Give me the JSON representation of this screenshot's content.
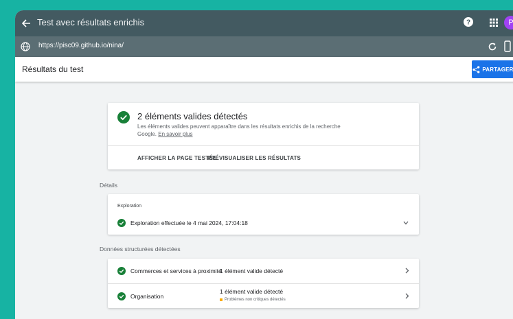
{
  "header": {
    "title": "Test avec résultats enrichis",
    "avatar_letter": "P"
  },
  "urlbar": {
    "url": "https://pisc09.github.io/nina/"
  },
  "appbar": {
    "heading": "Résultats du test",
    "share_label": "PARTAGER"
  },
  "summary": {
    "headline": "2 éléments valides détectés",
    "description": "Les éléments valides peuvent apparaître dans les résultats enrichis de la recherche Google.",
    "learn_more": "En savoir plus",
    "action_view": "AFFICHER LA PAGE TESTÉE",
    "action_preview": "PRÉVISUALISER LES RÉSULTATS"
  },
  "details": {
    "section_label": "Détails",
    "crawl_label": "Exploration",
    "crawl_status": "Exploration effectuée le 4 mai 2024, 17:04:18"
  },
  "structured_data": {
    "section_label": "Données structurées détectées",
    "rows": [
      {
        "name": "Commerces et services à proximité",
        "status": "1 élément valide détecté"
      },
      {
        "name": "Organisation",
        "status": "1 élément valide détecté",
        "warning": "Problèmes non critiques détectés"
      }
    ]
  },
  "colors": {
    "background": "#17b3a3",
    "topbar": "#435a61",
    "urlbar": "#5b6e74",
    "accent": "#1a73e8",
    "success": "#188038",
    "warning": "#f9ab00"
  }
}
